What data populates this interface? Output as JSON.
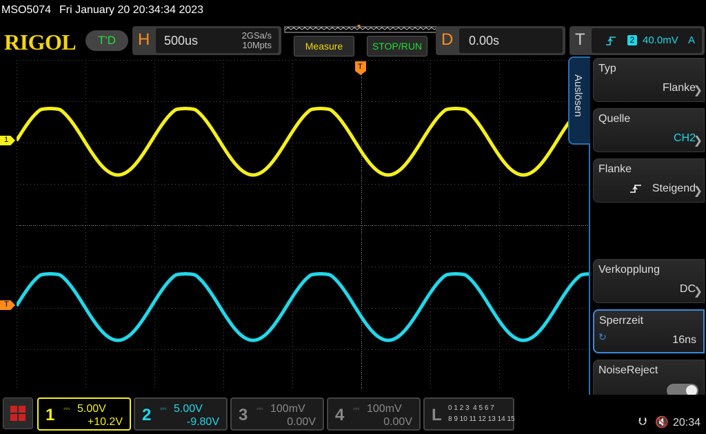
{
  "title_bar": {
    "model": "MSO5074",
    "datetime": "Fri January 20 20:34:34 2023"
  },
  "brand": {
    "logo": "RIGOL",
    "run_status": "T'D"
  },
  "horizontal": {
    "letter": "H",
    "timebase": "500us",
    "sample_rate": "2GSa/s",
    "memory_depth": "10Mpts"
  },
  "buttons": {
    "measure": "Measure",
    "stop_run": "STOP/RUN"
  },
  "delay": {
    "letter": "D",
    "value": "0.00s"
  },
  "trigger_status": {
    "letter": "T",
    "source": "2",
    "level": "40.0mV",
    "mode": "A"
  },
  "side_menu": {
    "tab": "Auslösen",
    "items": [
      {
        "label": "Typ",
        "value": "Flanke"
      },
      {
        "label": "Quelle",
        "value": "CH2"
      },
      {
        "label": "Flanke",
        "value": "Steigend"
      },
      {
        "label": "Verkopplung",
        "value": "DC"
      },
      {
        "label": "Sperrzeit",
        "value": "16ns"
      },
      {
        "label": "NoiseReject",
        "value": ""
      }
    ]
  },
  "markers": {
    "ch1": "1",
    "trigger": "T"
  },
  "channels": [
    {
      "num": "1",
      "scale": "5.00V",
      "offset": "+10.2V",
      "color": "#f5f01a",
      "active": true
    },
    {
      "num": "2",
      "scale": "5.00V",
      "offset": "-9.80V",
      "color": "#22d7e8",
      "active": true
    },
    {
      "num": "3",
      "scale": "100mV",
      "offset": "0.00V",
      "color": "#888888",
      "active": false
    },
    {
      "num": "4",
      "scale": "100mV",
      "offset": "0.00V",
      "color": "#888888",
      "active": false
    }
  ],
  "logic": {
    "letter": "L",
    "row1": "0 1 2 3  4 5 6 7",
    "row2": "8 9 10 11 12 13 14 15"
  },
  "status": {
    "time": "20:34"
  },
  "colors": {
    "ch1": "#f5f01a",
    "ch2": "#22d7e8",
    "accent": "#ff8c1a",
    "menu_border": "#2a6fb5"
  }
}
